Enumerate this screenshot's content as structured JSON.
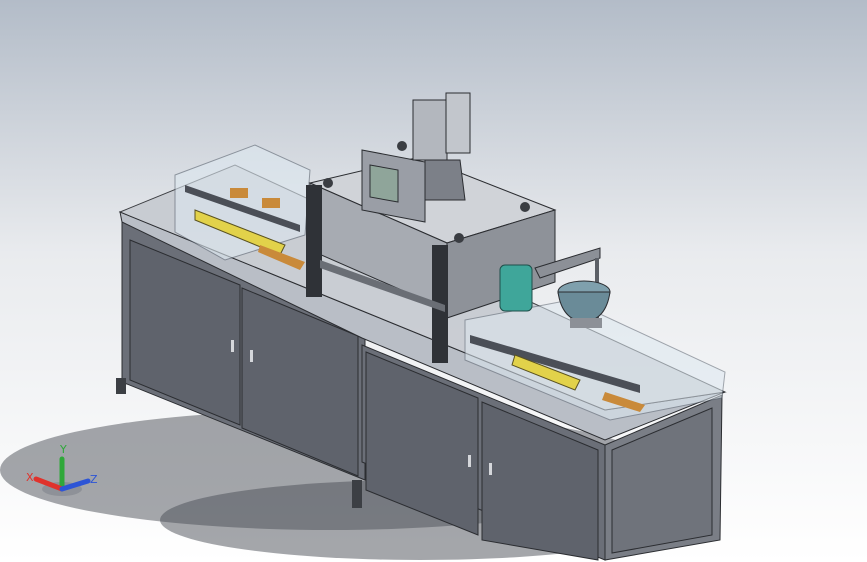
{
  "triad": {
    "x_label": "X",
    "y_label": "Y",
    "z_label": "Z",
    "x_color": "#e0322c",
    "y_color": "#2fa83a",
    "z_color": "#2d55d6"
  },
  "colors": {
    "cabinet_side": "#6d717a",
    "cabinet_front": "#5e626b",
    "tabletop": "#c4c8ce",
    "glass": "#d8e6ef",
    "bowl": "#7fa0ad",
    "screen": "#8fa59a",
    "accent_yellow": "#e2d24a",
    "accent_orange": "#c98a3a",
    "teal": "#3fa69a"
  }
}
